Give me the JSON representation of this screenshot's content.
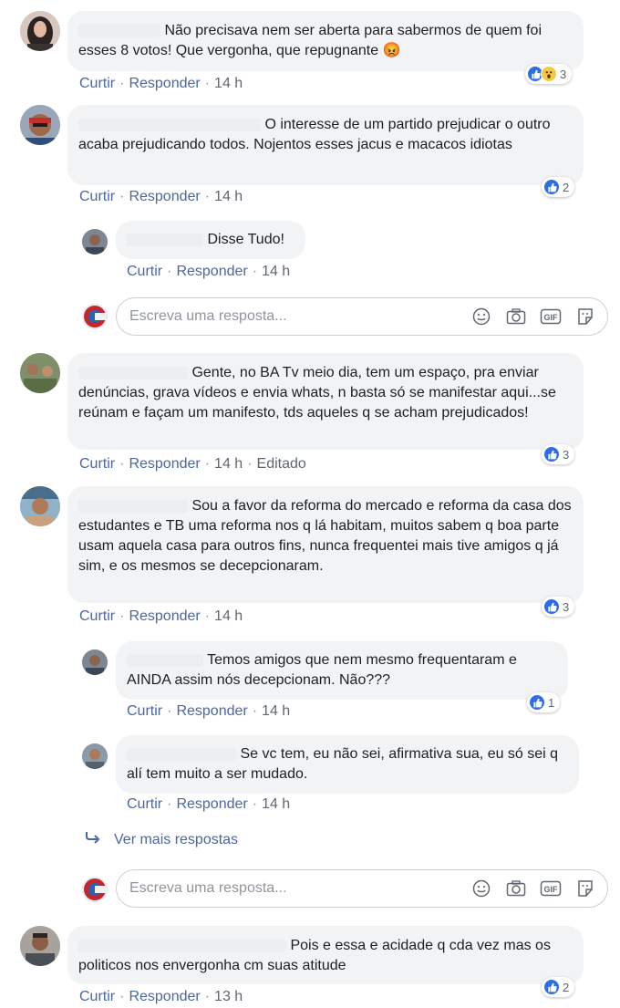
{
  "labels": {
    "like": "Curtir",
    "reply": "Responder",
    "dot": "·",
    "edited": "Editado"
  },
  "comments": [
    {
      "text": "Não precisava nem ser aberta para sabermos de quem foi esses 8 votos! Que vergonha, que repugnante 😡",
      "time": "14 h",
      "reaction_count": "3",
      "reaction_icons": [
        "like-icon",
        "wow-icon"
      ]
    },
    {
      "text": "O interesse de um partido prejudicar o outro acaba prejudicando todos. Nojentos esses jacus e macacos idiotas",
      "time": "14 h",
      "reaction_count": "2",
      "reaction_icons": [
        "like-icon"
      ]
    },
    {
      "text": "Gente, no BA Tv meio dia, tem um espaço, pra enviar denúncias, grava vídeos e envia whats, n basta só se manifestar aqui...se reúnam e façam um manifesto, tds aqueles q se acham prejudicados!",
      "time": "14 h",
      "edited": "Editado",
      "reaction_count": "3",
      "reaction_icons": [
        "like-icon"
      ]
    },
    {
      "text": "Sou a favor da reforma do mercado e reforma da casa dos estudantes e TB uma reforma nos q lá habitam, muitos sabem q boa parte usam aquela casa para outros fins, nunca frequentei mais tive amigos q já sim, e os mesmos se decepcionaram.",
      "time": "14 h",
      "reaction_count": "3",
      "reaction_icons": [
        "like-icon"
      ]
    },
    {
      "text": "Pois e essa e acidade q cda vez mas os politicos nos envergonha cm suas atitude",
      "time": "13 h",
      "reaction_count": "2",
      "reaction_icons": [
        "like-icon"
      ]
    }
  ],
  "replies": [
    {
      "text": "Disse Tudo!",
      "time": "14 h"
    },
    {
      "text": "Temos amigos que nem mesmo frequentaram e AINDA assim nós decepcionam. Não???",
      "time": "14 h",
      "reaction_count": "1",
      "reaction_icons": [
        "like-icon"
      ]
    },
    {
      "text": "Se vc tem, eu não sei, afirmativa sua, eu só sei q alí tem muito a ser mudado.",
      "time": "14 h"
    }
  ],
  "reply_input": {
    "placeholder": "Escreva uma resposta...",
    "value": ""
  },
  "reply_tools": [
    "emoji-icon",
    "camera-icon",
    "gif-icon",
    "sticker-icon"
  ],
  "gif_label": "GIF",
  "more_replies_label": "Ver mais respostas",
  "colors": {
    "link": "#4b66a1",
    "meta": "#606770",
    "bubble": "#f2f3f5",
    "like": "#2d6ee6",
    "wow": "#f7c743"
  }
}
